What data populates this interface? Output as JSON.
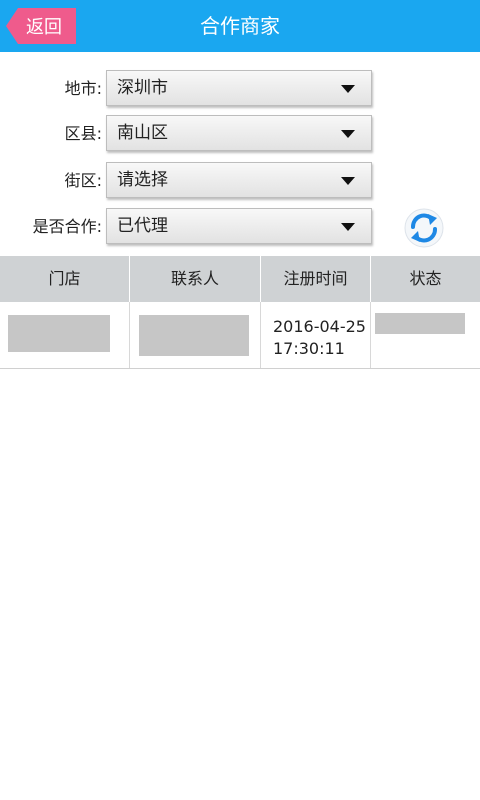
{
  "header": {
    "back_label": "返回",
    "title": "合作商家",
    "bg_color": "#1aa7f0",
    "back_color": "#ef5b8c"
  },
  "filters": [
    {
      "label": "地市:",
      "value": "深圳市"
    },
    {
      "label": "区县:",
      "value": "南山区"
    },
    {
      "label": "街区:",
      "value": "请选择"
    },
    {
      "label": "是否合作:",
      "value": "已代理"
    }
  ],
  "refresh_icon": "refresh-icon",
  "table": {
    "headers": [
      "门店",
      "联系人",
      "注册时间",
      "状态"
    ],
    "rows": [
      {
        "store": "",
        "contact": "",
        "time_date": "2016-04-25",
        "time_clock": "17:30:11",
        "status": ""
      }
    ]
  }
}
